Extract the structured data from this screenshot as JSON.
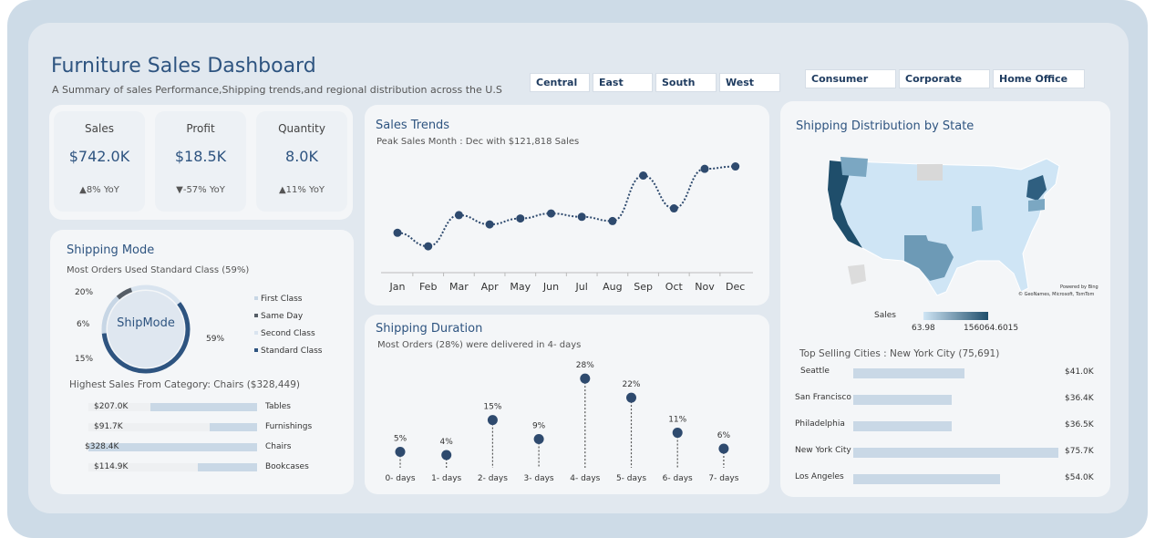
{
  "header": {
    "title": "Furniture Sales Dashboard",
    "subtitle": "A Summary  of sales Performance,Shipping trends,and regional distribution across the U.S"
  },
  "region_slicer": [
    "Central",
    "East",
    "South",
    "West"
  ],
  "segment_slicer": [
    "Consumer",
    "Corporate",
    "Home Office"
  ],
  "kpis": [
    {
      "label": "Sales",
      "value": "$742.0K",
      "yoy": "▲8% YoY"
    },
    {
      "label": "Profit",
      "value": "$18.5K",
      "yoy": "▼-57% YoY"
    },
    {
      "label": "Quantity",
      "value": "8.0K",
      "yoy": "▲11% YoY"
    }
  ],
  "shipping_mode": {
    "title": "Shipping Mode",
    "subtitle": "Most Orders Used  Standard Class (59%)",
    "center_label": "ShipMode",
    "chart_data": {
      "type": "pie",
      "categories": [
        "First Class",
        "Same Day",
        "Second Class",
        "Standard Class"
      ],
      "values": [
        15,
        6,
        20,
        59
      ],
      "labels": [
        "15%",
        "6%",
        "20%",
        "59%"
      ]
    },
    "legend": [
      "First Class",
      "Same Day",
      "Second Class",
      "Standard Class"
    ],
    "colors": [
      "#c7d6e5",
      "#555d66",
      "#d9e4ef",
      "#2e5480"
    ]
  },
  "category": {
    "title": "Highest Sales From Category: Chairs ($328,449)",
    "chart_data": {
      "type": "bar",
      "categories": [
        "Tables",
        "Furnishings",
        "Chairs",
        "Bookcases"
      ],
      "values": [
        207.0,
        91.7,
        328.4,
        114.9
      ],
      "labels": [
        "$207.0K",
        "$91.7K",
        "$328.4K",
        "$114.9K"
      ],
      "xlim": [
        0,
        328.4
      ]
    }
  },
  "sales_trends": {
    "title": "Sales Trends",
    "subtitle": "Peak Sales Month : Dec with  $121,818  Sales",
    "chart_data": {
      "type": "line",
      "categories": [
        "Jan",
        "Feb",
        "Mar",
        "Apr",
        "May",
        "Jun",
        "Jul",
        "Aug",
        "Sep",
        "Oct",
        "Nov",
        "Dec"
      ],
      "values": [
        43000,
        27000,
        64000,
        53000,
        60000,
        66000,
        62000,
        57000,
        111000,
        72000,
        119000,
        121818
      ],
      "ylim": [
        0,
        130000
      ]
    }
  },
  "shipping_duration": {
    "title": "Shipping Duration",
    "subtitle": "Most Orders  (28%) were delivered in  4- days",
    "chart_data": {
      "type": "scatter",
      "categories": [
        "0- days",
        "1- days",
        "2- days",
        "3- days",
        "4- days",
        "5- days",
        "6- days",
        "7- days"
      ],
      "values": [
        5,
        4,
        15,
        9,
        28,
        22,
        11,
        6
      ],
      "labels": [
        "5%",
        "4%",
        "15%",
        "9%",
        "28%",
        "22%",
        "11%",
        "6%"
      ],
      "ylim": [
        0,
        30
      ]
    }
  },
  "map": {
    "title": "Shipping Distribution by State",
    "legend_title": "Sales",
    "legend_min": "63.98",
    "legend_max": "156064.6015",
    "credit1": "Powered by Bing",
    "credit2": "© GeoNames, Microsoft, TomTom"
  },
  "cities": {
    "title": "Top Selling Cities : New York City (75,691)",
    "chart_data": {
      "type": "bar",
      "categories": [
        "Seattle",
        "San Francisco",
        "Philadelphia",
        "New York City",
        "Los Angeles"
      ],
      "values": [
        41.0,
        36.4,
        36.5,
        75.7,
        54.0
      ],
      "labels": [
        "$41.0K",
        "$36.4K",
        "$36.5K",
        "$75.7K",
        "$54.0K"
      ],
      "xlim": [
        0,
        75.7
      ]
    }
  },
  "colors": {
    "accent": "#2e5480",
    "light": "#c9d8e6",
    "background": "#e1e8ef"
  }
}
